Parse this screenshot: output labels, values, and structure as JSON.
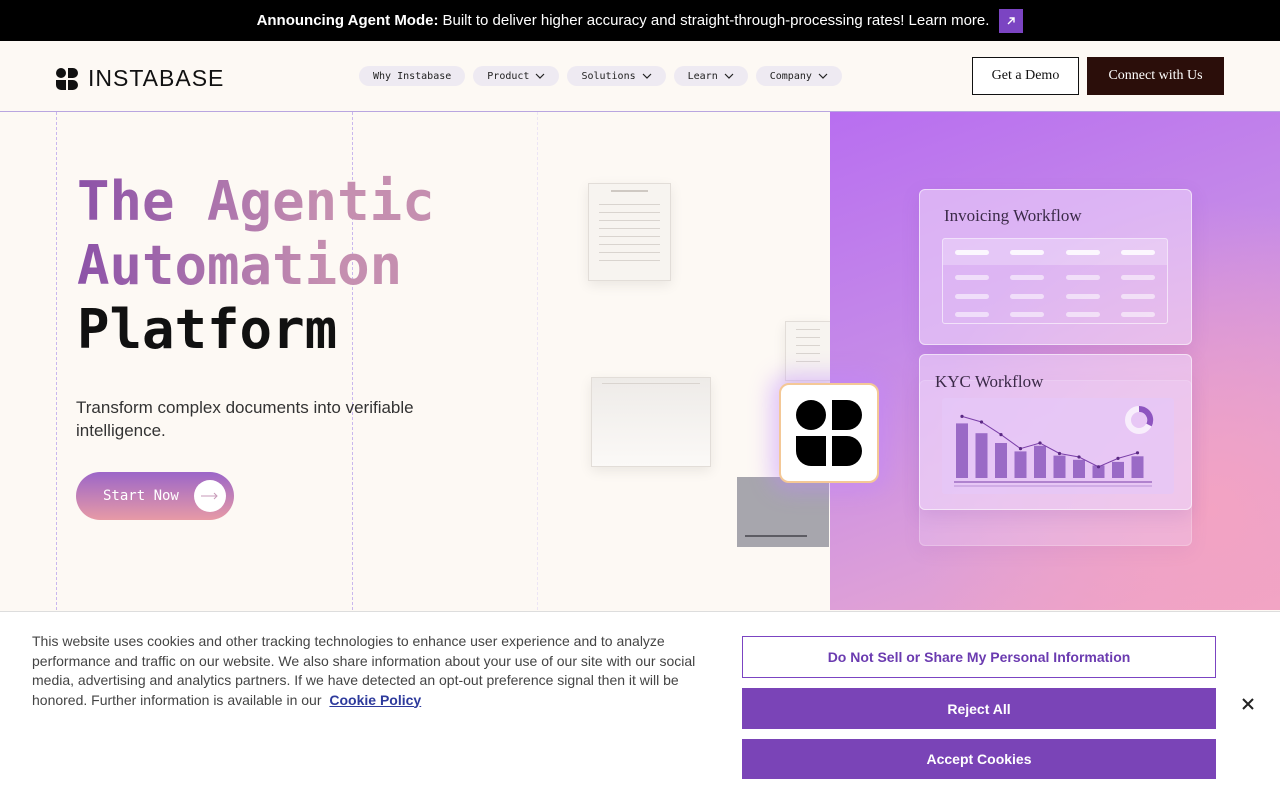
{
  "announcement": {
    "bold": "Announcing Agent Mode:",
    "text": "Built to deliver higher accuracy and straight-through-processing rates! Learn more.",
    "icon": "external-arrow-icon"
  },
  "header": {
    "logo_text": "INSTABASE",
    "nav": [
      {
        "label": "Why Instabase",
        "has_dropdown": false
      },
      {
        "label": "Product",
        "has_dropdown": true
      },
      {
        "label": "Solutions",
        "has_dropdown": true
      },
      {
        "label": "Learn",
        "has_dropdown": true
      },
      {
        "label": "Company",
        "has_dropdown": true
      }
    ],
    "demo_label": "Get a Demo",
    "connect_label": "Connect with Us"
  },
  "hero": {
    "title_line1": "The Agentic",
    "title_line2": "Automation",
    "title_line3": "Platform",
    "subtitle": "Transform complex documents into verifiable intelligence.",
    "cta_label": "Start Now"
  },
  "illustration": {
    "invoicing_title": "Invoicing Workflow",
    "kyc_title": "KYC Workflow",
    "kyc_bars": [
      0.78,
      0.64,
      0.5,
      0.38,
      0.46,
      0.32,
      0.26,
      0.18,
      0.23,
      0.31
    ],
    "kyc_line": [
      0.88,
      0.8,
      0.62,
      0.42,
      0.5,
      0.35,
      0.3,
      0.16,
      0.28,
      0.36
    ]
  },
  "cookie": {
    "text": "This website uses cookies and other tracking technologies to enhance user experience and to analyze performance and traffic on our website. We also share information about your use of our site with our social media, advertising and analytics partners. If we have detected an opt-out preference signal then it will be honored. Further information is available in our",
    "policy_link": "Cookie Policy",
    "do_not_sell": "Do Not Sell or Share My Personal Information",
    "reject": "Reject All",
    "accept": "Accept Cookies",
    "close_icon": "close-icon"
  },
  "colors": {
    "accent_purple": "#7a44b7",
    "dark_brown": "#2b0e0a",
    "background": "#fdf9f4"
  }
}
